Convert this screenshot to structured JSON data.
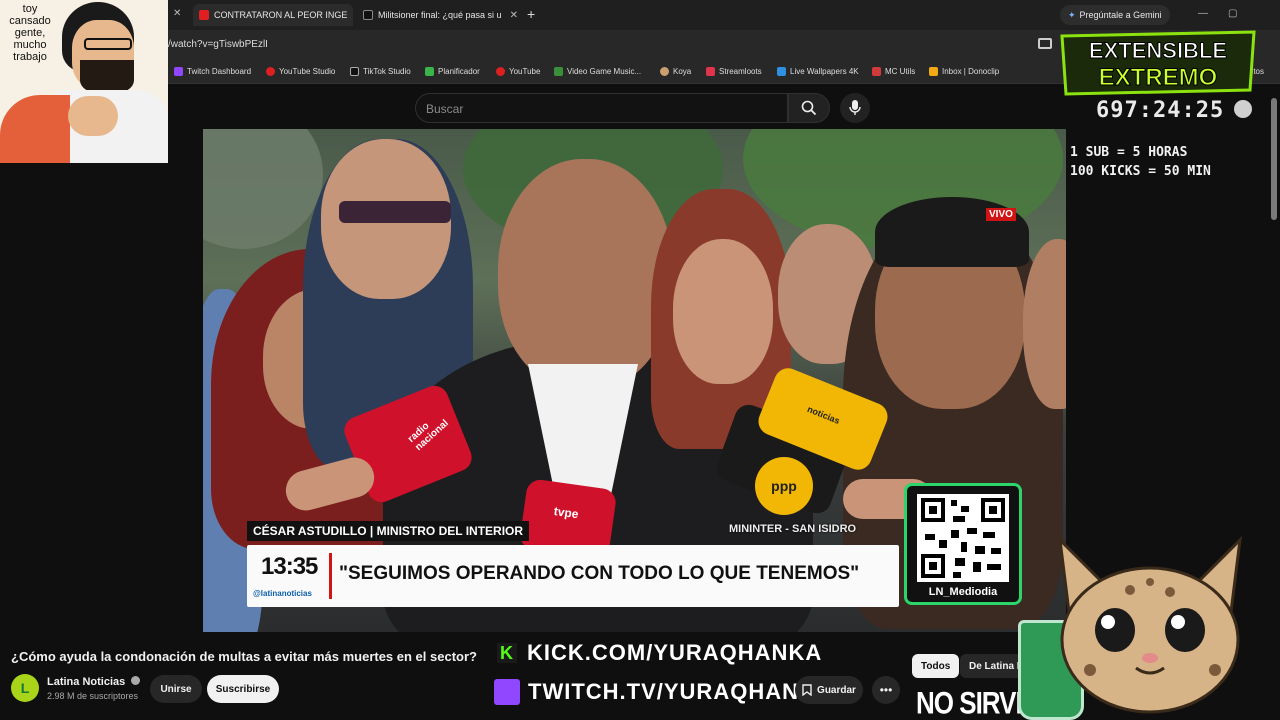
{
  "browser": {
    "tabs": [
      {
        "title": "CONTRATARON AL PEOR INGE"
      },
      {
        "title": "Militsioner final: ¿qué pasa si u"
      }
    ],
    "gemini_button": "Pregúntale a Gemini",
    "url": "/watch?v=gTiswbPEzlI",
    "bookmarks": [
      "Twitch Dashboard",
      "YouTube Studio",
      "TikTok Studio",
      "Planificador",
      "YouTube",
      "Video Game Music...",
      "Koya",
      "Streamloots",
      "Live Wallpapers 4K",
      "MC Utils",
      "Inbox | Donoclip",
      "vorıtos"
    ]
  },
  "youtube": {
    "search_placeholder": "Buscar",
    "video": {
      "live_badge": "VIVO",
      "lower_third_name": "CÉSAR ASTUDILLO | MINISTRO DEL INTERIOR",
      "lower_third_place": "MININTER - SAN ISIDRO",
      "time": "13:35",
      "handle": "@latinanoticias",
      "quote": "\"SEGUIMOS OPERANDO CON TODO LO QUE TENEMOS\"",
      "qr_label": "LN_Mediodia",
      "mic_labels": [
        "radio nacional",
        "tvpe",
        "ppp",
        "noticias"
      ]
    },
    "title": "¿Cómo ayuda la condonación de multas a evitar más muertes en el sector?",
    "channel": {
      "name": "Latina Noticias",
      "subscribers": "2.98 M de suscriptores",
      "avatar_letter": "L"
    },
    "buttons": {
      "join": "Unirse",
      "subscribe": "Suscribirse",
      "save": "Guardar",
      "more": "•••"
    },
    "chips": [
      "Todos",
      "De Latina N"
    ]
  },
  "overlay": {
    "webcam_text": [
      "toy",
      "cansado",
      "gente,",
      "mucho",
      "trabajo"
    ],
    "logo_line1": "EXTENSIBLE",
    "logo_line2": "EXTREMO",
    "timer": "697:24:25",
    "rule1": "1 SUB = 5 HORAS",
    "rule2": "100 KICKS = 50 MIN",
    "kick_url": "KICK.COM/YURAQHANKA",
    "twitch_url": "TWITCH.TV/YURAQHANKAA",
    "no_sirve": "NO SIRVE"
  }
}
